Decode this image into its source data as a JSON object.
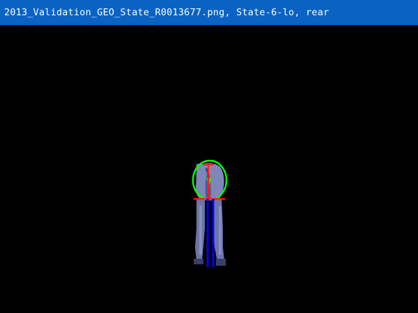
{
  "window": {
    "title": "2013_Validation_GEO_State_R0013677.png, State-6-lo, rear"
  },
  "colors": {
    "title_bar": "#0a63c2",
    "title_text": "#ffffff",
    "background": "#000000",
    "subject_fill": "#7f86b8",
    "subject_shade": "#4a5080",
    "ellipse_outline": "#00ff00",
    "marker_red": "#ff1a1a",
    "marker_blue": "#0000ff",
    "marker_green": "#00ff00"
  },
  "subject": {
    "description_icon": "horse-rear-view-icon"
  }
}
